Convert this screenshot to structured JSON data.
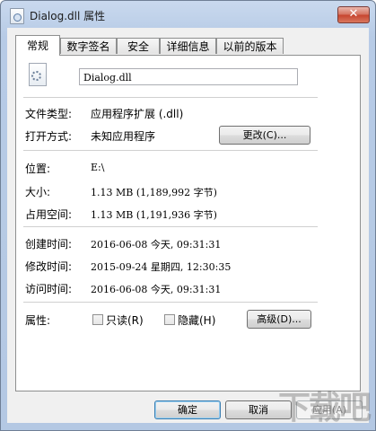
{
  "window": {
    "title": "Dialog.dll 属性",
    "close_glyph": "✕"
  },
  "tabs": [
    {
      "label": "常规",
      "active": true
    },
    {
      "label": "数字签名"
    },
    {
      "label": "安全"
    },
    {
      "label": "详细信息"
    },
    {
      "label": "以前的版本"
    }
  ],
  "general": {
    "filename": "Dialog.dll",
    "file_type_label": "文件类型:",
    "file_type_value": "应用程序扩展 (.dll)",
    "opens_with_label": "打开方式:",
    "opens_with_value": "未知应用程序",
    "change_button": "更改(C)...",
    "location_label": "位置:",
    "location_value": "E:\\",
    "size_label": "大小:",
    "size_value": "1.13 MB (1,189,992 字节)",
    "size_on_disk_label": "占用空间:",
    "size_on_disk_value": "1.13 MB (1,191,936 字节)",
    "created_label": "创建时间:",
    "created_value": "2016-06-08 今天, 09:31:31",
    "modified_label": "修改时间:",
    "modified_value": "2015-09-24 星期四, 12:30:35",
    "accessed_label": "访问时间:",
    "accessed_value": "2016-06-08 今天, 09:31:31",
    "attributes_label": "属性:",
    "readonly_label": "只读(R)",
    "hidden_label": "隐藏(H)",
    "advanced_button": "高级(D)..."
  },
  "footer": {
    "ok": "确定",
    "cancel": "取消",
    "apply": "应用(A)"
  },
  "watermark": "下载吧"
}
